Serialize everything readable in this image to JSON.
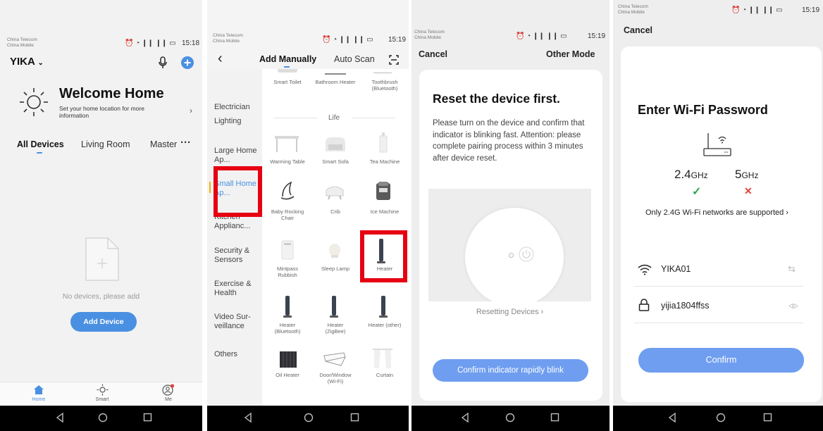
{
  "status": {
    "carrier1": "China Telecom",
    "carrier2": "China Mobile",
    "icons": "⏰ ◔ ❙❙ ❙❙ ▭",
    "time1": "15:18",
    "time2": "15:19",
    "time3": "15:19",
    "time4": "15:19"
  },
  "screen1": {
    "home_name": "YIKA",
    "welcome_title": "Welcome Home",
    "welcome_sub": "Set your home location for more information",
    "tabs": [
      "All Devices",
      "Living Room",
      "Master"
    ],
    "more": "···",
    "empty_text": "No devices, please add",
    "add_button": "Add Device",
    "bottom_nav": [
      "Home",
      "Smart",
      "Me"
    ]
  },
  "screen2": {
    "tab_manual": "Add Manually",
    "tab_auto": "Auto Scan",
    "categories": [
      "Electrician",
      "Lighting",
      "Large Home Ap...",
      "Small Home Ap...",
      "Kitchen Applianc...",
      "Security & Sensors",
      "Exercise & Health",
      "Video Sur- veillance",
      "Others"
    ],
    "section": "Life",
    "items": [
      "Smart Toilet",
      "Bathroom Heater",
      "Toothbrush (Bluetooth)",
      "Warming Table",
      "Smart Sofa",
      "Tea Machine",
      "Baby Rocking Chair",
      "Crib",
      "Ice Machine",
      "Mintpass Rubbish",
      "Sleep Lamp",
      "Heater",
      "Heater (Bluetooth)",
      "Heater (ZigBee)",
      "Heater (other)",
      "Oil Heater",
      "Door/Window (Wi-Fi)",
      "Curtain"
    ]
  },
  "screen3": {
    "cancel": "Cancel",
    "other_mode": "Other Mode",
    "title": "Reset the device first.",
    "instructions": "Please turn on the device and confirm that indicator is blinking fast. Attention: please complete pairing process within 3 minutes after device reset.",
    "resetting_link": "Resetting Devices ›",
    "confirm_button": "Confirm indicator rapidly blink"
  },
  "screen4": {
    "cancel": "Cancel",
    "title": "Enter Wi-Fi Password",
    "band24": "2.4",
    "band5": "5",
    "ghz": "GHz",
    "check": "✓",
    "cross": "✕",
    "note": "Only 2.4G Wi-Fi networks are supported ›",
    "ssid": "YIKA01",
    "password": "yijia1804ffss",
    "confirm": "Confirm"
  },
  "colors": {
    "accent": "#4a90e2",
    "button": "#6f9ef0",
    "highlight": "#e60012",
    "success": "#2ca84a",
    "error": "#e0433a"
  }
}
